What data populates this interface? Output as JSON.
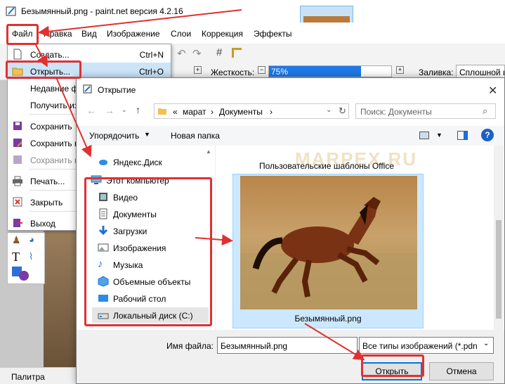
{
  "window": {
    "title": "Безымянный.png - paint.net версия 4.2.16"
  },
  "menubar": [
    "Файл",
    "Правка",
    "Вид",
    "Изображение",
    "Слои",
    "Коррекция",
    "Эффекты"
  ],
  "props": {
    "hardness_label": "Жесткость:",
    "hardness_value": "75%",
    "fill_label": "Заливка:",
    "fill_value": "Сплошной ц"
  },
  "file_menu": [
    {
      "label": "Создать...",
      "shortcut": "Ctrl+N",
      "icon": "new-file-icon"
    },
    {
      "label": "Открыть...",
      "shortcut": "Ctrl+O",
      "icon": "open-folder-icon"
    },
    {
      "label": "Недавние ф",
      "shortcut": "",
      "icon": ""
    },
    {
      "label": "Получить из",
      "shortcut": "",
      "icon": ""
    },
    {
      "label": "Сохранить",
      "shortcut": "",
      "icon": "save-icon"
    },
    {
      "label": "Сохранить к",
      "shortcut": "",
      "icon": "save-as-icon"
    },
    {
      "label": "Сохранить в",
      "shortcut": "",
      "icon": "save-all-icon"
    },
    {
      "label": "Печать...",
      "shortcut": "",
      "icon": "print-icon"
    },
    {
      "label": "Закрыть",
      "shortcut": "",
      "icon": "close-doc-icon"
    },
    {
      "label": "Выход",
      "shortcut": "",
      "icon": "exit-icon"
    }
  ],
  "palette_label": "Палитра",
  "dialog": {
    "title": "Открытие",
    "breadcrumb": [
      "«",
      "марат",
      "›",
      "Документы",
      "›"
    ],
    "search_placeholder": "Поиск: Документы",
    "organize": "Упорядочить",
    "new_folder": "Новая папка",
    "nav_items": [
      {
        "label": "Яндекс.Диск",
        "icon": "yandex-disk-icon"
      },
      {
        "label": "Этот компьютер",
        "icon": "computer-icon"
      },
      {
        "label": "Видео",
        "icon": "video-icon"
      },
      {
        "label": "Документы",
        "icon": "documents-icon"
      },
      {
        "label": "Загрузки",
        "icon": "download-icon"
      },
      {
        "label": "Изображения",
        "icon": "pictures-icon"
      },
      {
        "label": "Музыка",
        "icon": "music-icon"
      },
      {
        "label": "Объемные объекты",
        "icon": "3d-objects-icon"
      },
      {
        "label": "Рабочий стол",
        "icon": "desktop-icon"
      },
      {
        "label": "Локальный диск (C:)",
        "icon": "local-disk-icon"
      }
    ],
    "folder_label": "Пользовательские шаблоны Office",
    "file_name_label": "Безымянный.png",
    "filename_field_label": "Имя файла:",
    "filename_value": "Безымянный.png",
    "filetype_value": "Все типы изображений (*.pdn",
    "open_button": "Открыть",
    "cancel_button": "Отмена",
    "watermark": "MARPEX.RU"
  }
}
